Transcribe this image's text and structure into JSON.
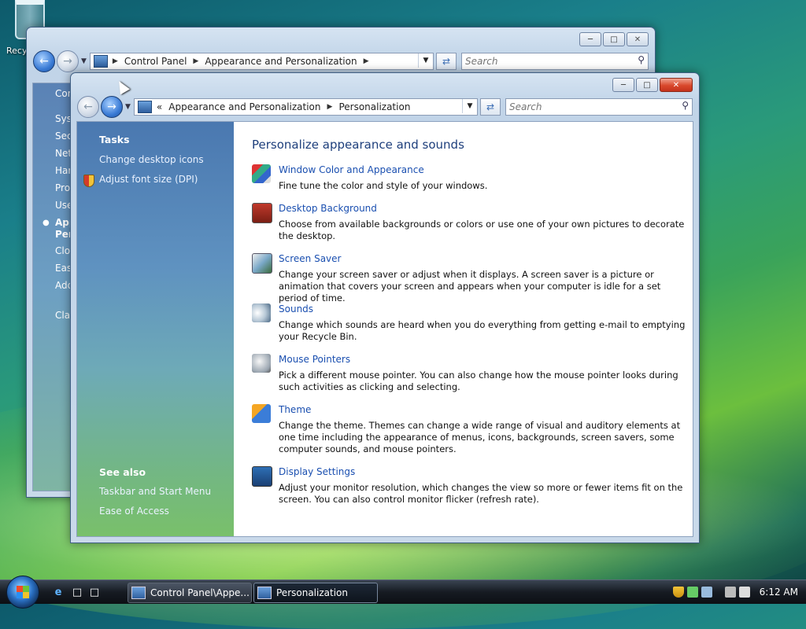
{
  "desktop": {
    "recycle_label": "Recy"
  },
  "back_window": {
    "breadcrumb": [
      "Control Panel",
      "Appearance and Personalization"
    ],
    "search_placeholder": "Search",
    "nav_items": [
      "Con",
      "Syst",
      "Sec",
      "Net",
      "Har",
      "Pro",
      "Use",
      "App",
      "Per",
      "Clo",
      "Eas",
      "Add",
      "Clas"
    ]
  },
  "front_window": {
    "breadcrumb_prefix": "«",
    "breadcrumb": [
      "Appearance and Personalization",
      "Personalization"
    ],
    "search_placeholder": "Search",
    "tasks": {
      "heading": "Tasks",
      "links": [
        "Change desktop icons",
        "Adjust font size (DPI)"
      ]
    },
    "see_also": {
      "heading": "See also",
      "links": [
        "Taskbar and Start Menu",
        "Ease of Access"
      ]
    },
    "main": {
      "title": "Personalize appearance and sounds",
      "items": [
        {
          "title": "Window Color and Appearance",
          "desc": "Fine tune the color and style of your windows.",
          "icon": "window-color-icon"
        },
        {
          "title": "Desktop Background",
          "desc": "Choose from available backgrounds or colors or use one of your own pictures to decorate the desktop.",
          "icon": "desktop-background-icon"
        },
        {
          "title": "Screen Saver",
          "desc": "Change your screen saver or adjust when it displays. A screen saver is a picture or animation that covers your screen and appears when your computer is idle for a set period of time.",
          "icon": "screen-saver-icon"
        },
        {
          "title": "Sounds",
          "desc": "Change which sounds are heard when you do everything from getting e-mail to emptying your Recycle Bin.",
          "icon": "sounds-icon"
        },
        {
          "title": "Mouse Pointers",
          "desc": "Pick a different mouse pointer. You can also change how the mouse pointer looks during such activities as clicking and selecting.",
          "icon": "mouse-pointers-icon"
        },
        {
          "title": "Theme",
          "desc": "Change the theme. Themes can change a wide range of visual and auditory elements at one time including the appearance of menus, icons, backgrounds, screen savers, some computer sounds, and mouse pointers.",
          "icon": "theme-icon"
        },
        {
          "title": "Display Settings",
          "desc": "Adjust your monitor resolution, which changes the view so more or fewer items fit on the screen. You can also control monitor flicker (refresh rate).",
          "icon": "display-settings-icon"
        }
      ]
    }
  },
  "taskbar": {
    "buttons": [
      "Control Panel\\Appe...",
      "Personalization"
    ],
    "clock": "6:12 AM"
  }
}
